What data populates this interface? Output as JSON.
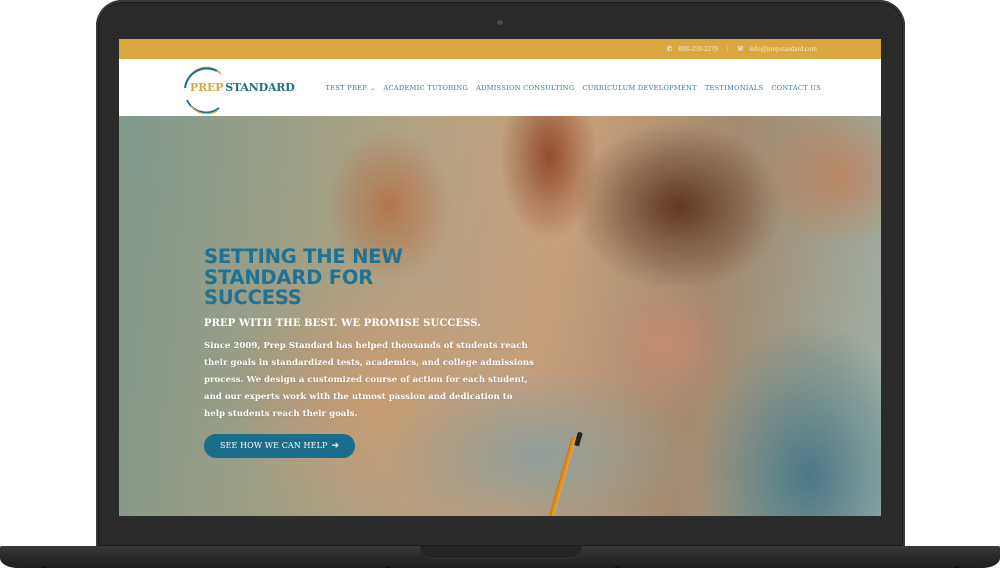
{
  "topbar": {
    "phone_icon": "phone-icon",
    "phone": "888-259-2279",
    "separator": "|",
    "email_icon": "envelope-icon",
    "email": "info@prepstandard.com"
  },
  "logo": {
    "prep": "PREP",
    "standard": "STANDARD"
  },
  "nav": {
    "items": [
      {
        "label": "TEST PREP",
        "has_dropdown": true,
        "dropdown_icon": "chevron-down-icon"
      },
      {
        "label": "ACADEMIC TUTORING"
      },
      {
        "label": "ADMISSION CONSULTING"
      },
      {
        "label": "CURRICULUM DEVELOPMENT"
      },
      {
        "label": "TESTIMONIALS"
      },
      {
        "label": "CONTACT US"
      }
    ],
    "chevron": "⌄"
  },
  "hero": {
    "title": "SETTING THE NEW STANDARD FOR SUCCESS",
    "subtitle": "PREP WITH THE BEST. WE PROMISE SUCCESS.",
    "body": "Since 2009, Prep Standard has helped thousands of students reach their goals in standardized tests, academics, and college admissions process. We design a customized course of action for each student, and our experts work with the utmost passion and dedication to help students reach their goals.",
    "cta_label": "SEE HOW WE CAN HELP",
    "cta_icon": "arrow-right-icon",
    "background_image": "students-taking-test-photo"
  },
  "colors": {
    "accent_gold": "#d9a73f",
    "brand_teal": "#1f7294",
    "nav_teal": "#2b7a99",
    "button_teal": "#1b6e8b",
    "device_frame": "#2b2b2b"
  }
}
